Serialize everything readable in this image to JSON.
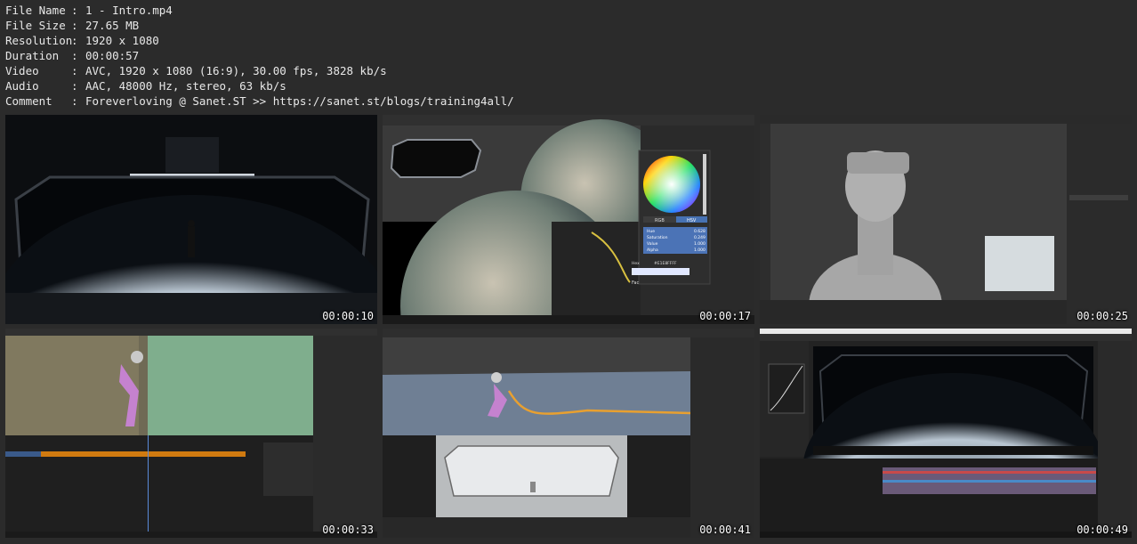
{
  "info": [
    {
      "key": "File Name",
      "value": "1 - Intro.mp4"
    },
    {
      "key": "File Size",
      "value": "27.65 MB"
    },
    {
      "key": "Resolution",
      "value": "1920 x 1080"
    },
    {
      "key": "Duration",
      "value": "00:00:57"
    },
    {
      "key": "Video",
      "value": "AVC, 1920 x 1080 (16:9), 30.00 fps, 3828 kb/s"
    },
    {
      "key": "Audio",
      "value": "AAC, 48000 Hz, stereo, 63 kb/s"
    },
    {
      "key": "Comment",
      "value": "Foreverloving @ Sanet.ST >> https://sanet.st/blogs/training4all/"
    }
  ],
  "separator": ":",
  "thumbnails": [
    {
      "timestamp": "00:00:10"
    },
    {
      "timestamp": "00:00:17"
    },
    {
      "timestamp": "00:00:25"
    },
    {
      "timestamp": "00:00:33"
    },
    {
      "timestamp": "00:00:41"
    },
    {
      "timestamp": "00:00:49"
    }
  ],
  "ui_text": {
    "color_mode_rgb": "RGB",
    "color_mode_hsv": "HSV",
    "hue_label": "Hue",
    "hue_value": "0.628",
    "saturation_label": "Saturation",
    "saturation_value": "0.249",
    "value_label": "Value",
    "value_value": "1.000",
    "alpha_label": "Alpha",
    "alpha_value": "1.000",
    "hex_label": "Hex",
    "hex_value": "#E1E8FFFF",
    "fac_label": "Fac"
  }
}
